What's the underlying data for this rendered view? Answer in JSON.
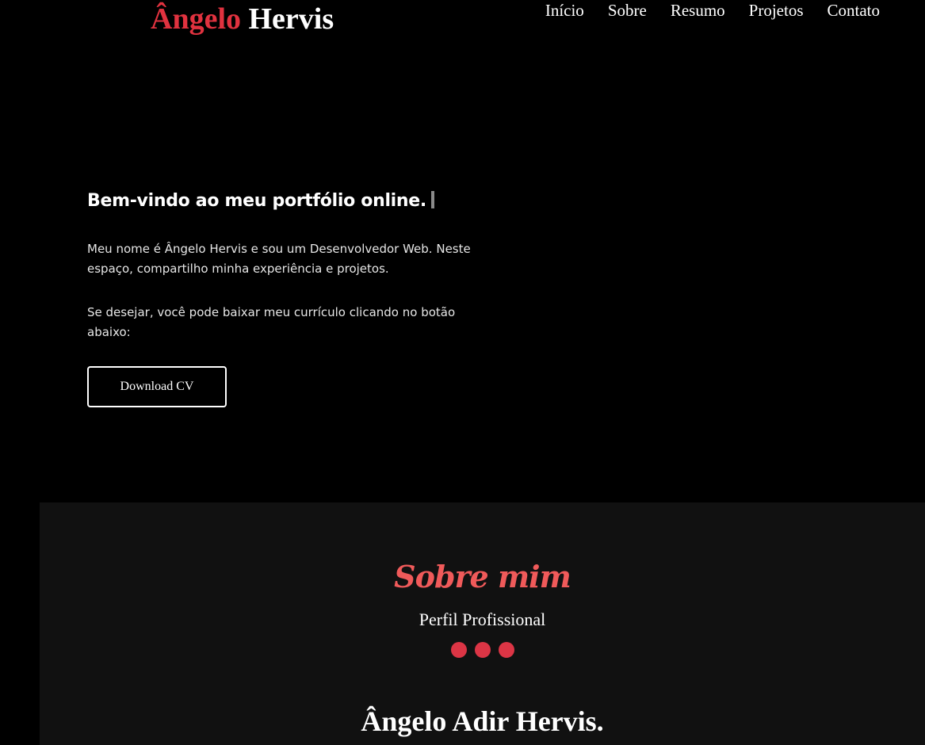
{
  "header": {
    "logo_first": "Ângelo",
    "logo_last": "Hervis",
    "nav": [
      {
        "label": "Início"
      },
      {
        "label": "Sobre"
      },
      {
        "label": "Resumo"
      },
      {
        "label": "Projetos"
      },
      {
        "label": "Contato"
      }
    ]
  },
  "hero": {
    "title": "Bem-vindo ao meu portfólio online.",
    "paragraph1": "Meu nome é Ângelo Hervis e sou um Desenvolvedor Web. Neste espaço, compartilho minha experiência e projetos.",
    "paragraph2": "Se desejar, você pode baixar meu currículo clicando no botão abaixo:",
    "download_label": "Download CV"
  },
  "about": {
    "title": "Sobre mim",
    "subtitle": "Perfil Profissional",
    "name": "Ângelo Adir Hervis."
  },
  "colors": {
    "accent_red": "#e0323f",
    "title_red": "#f05a5a",
    "dot_red": "#dc3545",
    "background": "#000000",
    "section_background": "#111111"
  }
}
